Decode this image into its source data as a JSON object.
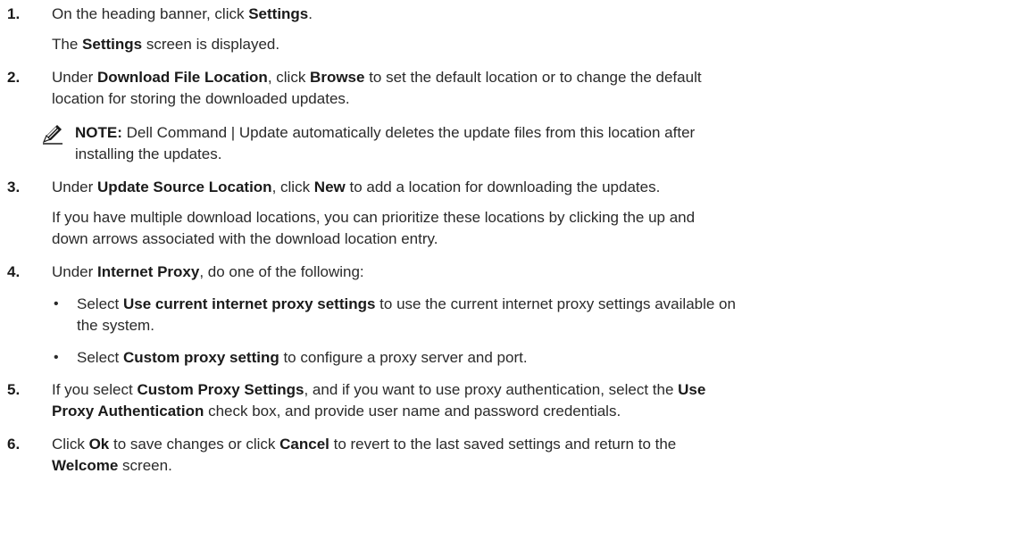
{
  "steps": [
    {
      "number": "1.",
      "lines": [
        {
          "parts": [
            {
              "t": "On the heading banner, click "
            },
            {
              "t": "Settings",
              "b": true
            },
            {
              "t": "."
            }
          ]
        },
        {
          "parts": [
            {
              "t": "The "
            },
            {
              "t": "Settings",
              "b": true
            },
            {
              "t": " screen is displayed."
            }
          ]
        }
      ]
    },
    {
      "number": "2.",
      "lines": [
        {
          "parts": [
            {
              "t": "Under "
            },
            {
              "t": "Download File Location",
              "b": true
            },
            {
              "t": ", click "
            },
            {
              "t": "Browse",
              "b": true
            },
            {
              "t": " to set the default location or to change the default"
            }
          ]
        },
        {
          "parts": [
            {
              "t": "location for storing the downloaded updates."
            }
          ]
        }
      ],
      "note": {
        "icon": "pencil-note-icon",
        "label": "NOTE:",
        "lines": [
          " Dell Command | Update automatically deletes the update files from this location after",
          "installing the updates."
        ]
      }
    },
    {
      "number": "3.",
      "lines": [
        {
          "parts": [
            {
              "t": "Under "
            },
            {
              "t": "Update Source Location",
              "b": true
            },
            {
              "t": ", click "
            },
            {
              "t": "New",
              "b": true
            },
            {
              "t": " to add a location for downloading the updates."
            }
          ]
        }
      ],
      "extra": [
        "If you have multiple download locations, you can prioritize these locations by clicking the up and",
        "down arrows associated with the download location entry."
      ]
    },
    {
      "number": "4.",
      "lines": [
        {
          "parts": [
            {
              "t": "Under "
            },
            {
              "t": "Internet Proxy",
              "b": true
            },
            {
              "t": ", do one of the following:"
            }
          ]
        }
      ],
      "bullets": [
        {
          "lines": [
            {
              "parts": [
                {
                  "t": "Select "
                },
                {
                  "t": "Use current internet proxy settings",
                  "b": true
                },
                {
                  "t": " to use the current internet proxy settings available on"
                }
              ]
            },
            {
              "parts": [
                {
                  "t": "the system."
                }
              ]
            }
          ]
        },
        {
          "lines": [
            {
              "parts": [
                {
                  "t": "Select "
                },
                {
                  "t": "Custom proxy setting",
                  "b": true
                },
                {
                  "t": " to configure a proxy server and port."
                }
              ]
            }
          ]
        }
      ]
    },
    {
      "number": "5.",
      "lines": [
        {
          "parts": [
            {
              "t": "If you select "
            },
            {
              "t": "Custom Proxy Settings",
              "b": true
            },
            {
              "t": ", and if you want to use proxy authentication, select the "
            },
            {
              "t": "Use",
              "b": true
            }
          ]
        },
        {
          "parts": [
            {
              "t": "Proxy Authentication",
              "b": true
            },
            {
              "t": " check box, and provide user name and password credentials."
            }
          ]
        }
      ]
    },
    {
      "number": "6.",
      "lines": [
        {
          "parts": [
            {
              "t": "Click "
            },
            {
              "t": "Ok",
              "b": true
            },
            {
              "t": " to save changes or click "
            },
            {
              "t": "Cancel",
              "b": true
            },
            {
              "t": " to revert to the last saved settings and return to the"
            }
          ]
        },
        {
          "parts": [
            {
              "t": "Welcome",
              "b": true
            },
            {
              "t": " screen."
            }
          ]
        }
      ]
    }
  ]
}
